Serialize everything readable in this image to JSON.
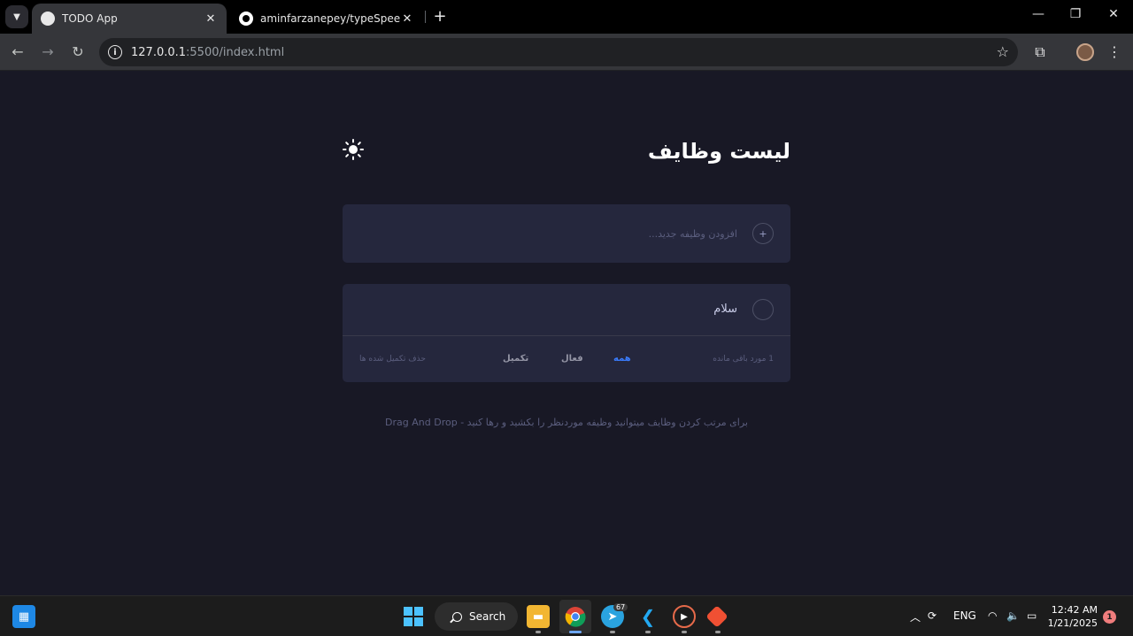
{
  "browser": {
    "tabs": [
      {
        "title": "TODO App",
        "active": true
      },
      {
        "title": "aminfarzanepey/typeSpeedTest",
        "active": false
      }
    ],
    "url": {
      "host": "127.0.0.1",
      "rest": ":5500/index.html"
    }
  },
  "app": {
    "title": "لیست وظایف",
    "add_placeholder": "افزودن وظیفه جدید...",
    "add_icon_glyph": "+",
    "todos": [
      {
        "text": "سلام",
        "completed": false
      }
    ],
    "footer": {
      "items_left": "1 مورد باقی مانده",
      "filters": {
        "all": "همه",
        "active": "فعال",
        "completed": "تکمیل"
      },
      "active_filter": "all",
      "clear_completed": "حذف تکمیل شده ها"
    },
    "hint": "برای مرتب کردن وظایف میتوانید وظیفه موردنظر را بکشید و رها کنید - Drag And Drop",
    "colors": {
      "background": "#181825",
      "card": "#25273d",
      "accent": "#3a7cfd",
      "text": "#c8cbe7",
      "muted": "#5b5e7e"
    }
  },
  "taskbar": {
    "search_label": "Search",
    "telegram_badge": "67",
    "language": "ENG",
    "time": "12:42 AM",
    "date": "1/21/2025",
    "notifications": "1"
  }
}
